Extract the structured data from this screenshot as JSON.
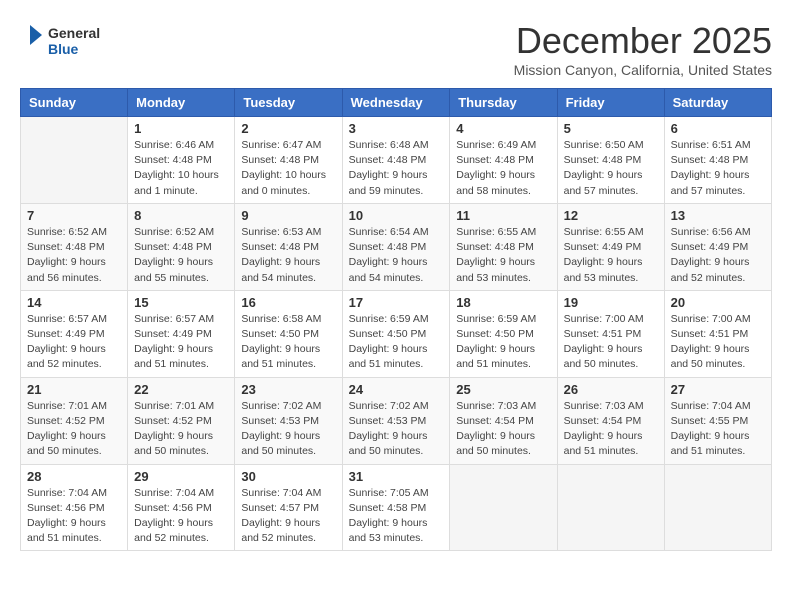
{
  "header": {
    "logo": {
      "general": "General",
      "blue": "Blue"
    },
    "title": "December 2025",
    "location": "Mission Canyon, California, United States"
  },
  "weekdays": [
    "Sunday",
    "Monday",
    "Tuesday",
    "Wednesday",
    "Thursday",
    "Friday",
    "Saturday"
  ],
  "weeks": [
    [
      {
        "day": "",
        "info": ""
      },
      {
        "day": "1",
        "info": "Sunrise: 6:46 AM\nSunset: 4:48 PM\nDaylight: 10 hours\nand 1 minute."
      },
      {
        "day": "2",
        "info": "Sunrise: 6:47 AM\nSunset: 4:48 PM\nDaylight: 10 hours\nand 0 minutes."
      },
      {
        "day": "3",
        "info": "Sunrise: 6:48 AM\nSunset: 4:48 PM\nDaylight: 9 hours\nand 59 minutes."
      },
      {
        "day": "4",
        "info": "Sunrise: 6:49 AM\nSunset: 4:48 PM\nDaylight: 9 hours\nand 58 minutes."
      },
      {
        "day": "5",
        "info": "Sunrise: 6:50 AM\nSunset: 4:48 PM\nDaylight: 9 hours\nand 57 minutes."
      },
      {
        "day": "6",
        "info": "Sunrise: 6:51 AM\nSunset: 4:48 PM\nDaylight: 9 hours\nand 57 minutes."
      }
    ],
    [
      {
        "day": "7",
        "info": "Sunrise: 6:52 AM\nSunset: 4:48 PM\nDaylight: 9 hours\nand 56 minutes."
      },
      {
        "day": "8",
        "info": "Sunrise: 6:52 AM\nSunset: 4:48 PM\nDaylight: 9 hours\nand 55 minutes."
      },
      {
        "day": "9",
        "info": "Sunrise: 6:53 AM\nSunset: 4:48 PM\nDaylight: 9 hours\nand 54 minutes."
      },
      {
        "day": "10",
        "info": "Sunrise: 6:54 AM\nSunset: 4:48 PM\nDaylight: 9 hours\nand 54 minutes."
      },
      {
        "day": "11",
        "info": "Sunrise: 6:55 AM\nSunset: 4:48 PM\nDaylight: 9 hours\nand 53 minutes."
      },
      {
        "day": "12",
        "info": "Sunrise: 6:55 AM\nSunset: 4:49 PM\nDaylight: 9 hours\nand 53 minutes."
      },
      {
        "day": "13",
        "info": "Sunrise: 6:56 AM\nSunset: 4:49 PM\nDaylight: 9 hours\nand 52 minutes."
      }
    ],
    [
      {
        "day": "14",
        "info": "Sunrise: 6:57 AM\nSunset: 4:49 PM\nDaylight: 9 hours\nand 52 minutes."
      },
      {
        "day": "15",
        "info": "Sunrise: 6:57 AM\nSunset: 4:49 PM\nDaylight: 9 hours\nand 51 minutes."
      },
      {
        "day": "16",
        "info": "Sunrise: 6:58 AM\nSunset: 4:50 PM\nDaylight: 9 hours\nand 51 minutes."
      },
      {
        "day": "17",
        "info": "Sunrise: 6:59 AM\nSunset: 4:50 PM\nDaylight: 9 hours\nand 51 minutes."
      },
      {
        "day": "18",
        "info": "Sunrise: 6:59 AM\nSunset: 4:50 PM\nDaylight: 9 hours\nand 51 minutes."
      },
      {
        "day": "19",
        "info": "Sunrise: 7:00 AM\nSunset: 4:51 PM\nDaylight: 9 hours\nand 50 minutes."
      },
      {
        "day": "20",
        "info": "Sunrise: 7:00 AM\nSunset: 4:51 PM\nDaylight: 9 hours\nand 50 minutes."
      }
    ],
    [
      {
        "day": "21",
        "info": "Sunrise: 7:01 AM\nSunset: 4:52 PM\nDaylight: 9 hours\nand 50 minutes."
      },
      {
        "day": "22",
        "info": "Sunrise: 7:01 AM\nSunset: 4:52 PM\nDaylight: 9 hours\nand 50 minutes."
      },
      {
        "day": "23",
        "info": "Sunrise: 7:02 AM\nSunset: 4:53 PM\nDaylight: 9 hours\nand 50 minutes."
      },
      {
        "day": "24",
        "info": "Sunrise: 7:02 AM\nSunset: 4:53 PM\nDaylight: 9 hours\nand 50 minutes."
      },
      {
        "day": "25",
        "info": "Sunrise: 7:03 AM\nSunset: 4:54 PM\nDaylight: 9 hours\nand 50 minutes."
      },
      {
        "day": "26",
        "info": "Sunrise: 7:03 AM\nSunset: 4:54 PM\nDaylight: 9 hours\nand 51 minutes."
      },
      {
        "day": "27",
        "info": "Sunrise: 7:04 AM\nSunset: 4:55 PM\nDaylight: 9 hours\nand 51 minutes."
      }
    ],
    [
      {
        "day": "28",
        "info": "Sunrise: 7:04 AM\nSunset: 4:56 PM\nDaylight: 9 hours\nand 51 minutes."
      },
      {
        "day": "29",
        "info": "Sunrise: 7:04 AM\nSunset: 4:56 PM\nDaylight: 9 hours\nand 52 minutes."
      },
      {
        "day": "30",
        "info": "Sunrise: 7:04 AM\nSunset: 4:57 PM\nDaylight: 9 hours\nand 52 minutes."
      },
      {
        "day": "31",
        "info": "Sunrise: 7:05 AM\nSunset: 4:58 PM\nDaylight: 9 hours\nand 53 minutes."
      },
      {
        "day": "",
        "info": ""
      },
      {
        "day": "",
        "info": ""
      },
      {
        "day": "",
        "info": ""
      }
    ]
  ]
}
